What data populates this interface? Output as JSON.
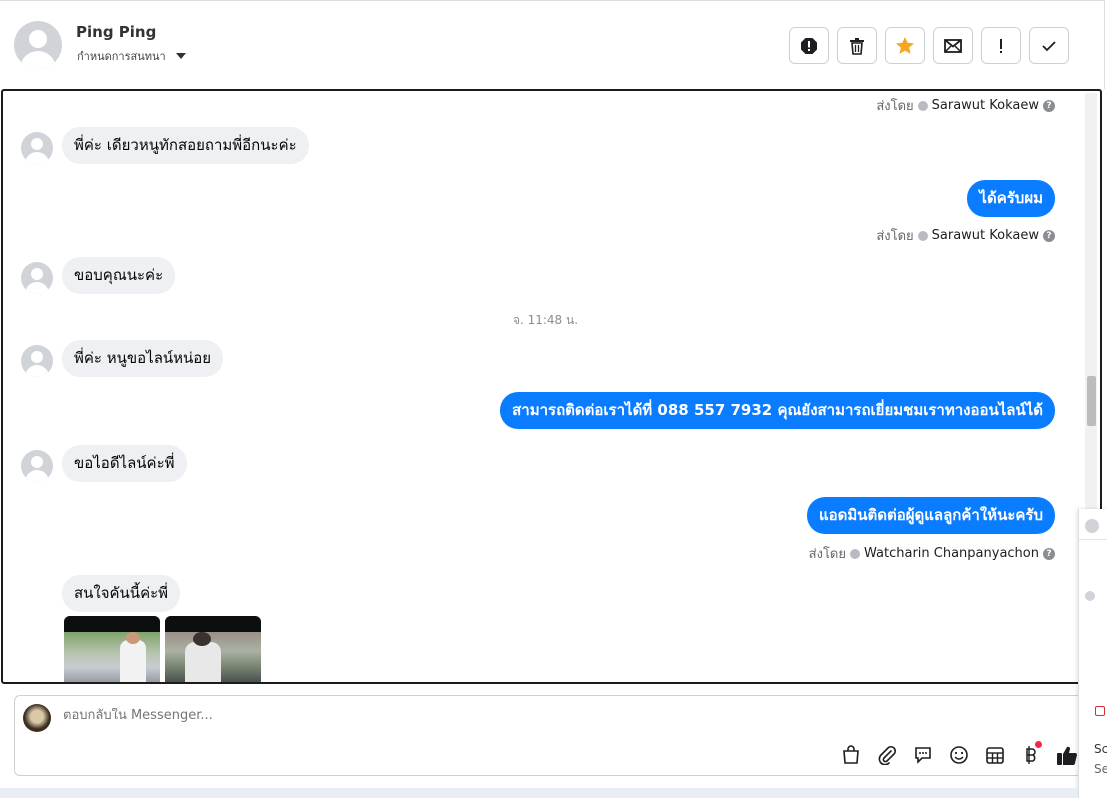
{
  "header": {
    "contact_name": "Ping Ping",
    "settings_label": "กำหนดการสนทนา",
    "actions": [
      {
        "name": "report-spam-button",
        "icon": "exclamation-octagon-icon"
      },
      {
        "name": "delete-button",
        "icon": "trash-icon"
      },
      {
        "name": "star-button",
        "icon": "star-icon"
      },
      {
        "name": "mark-unread-button",
        "icon": "envelope-icon"
      },
      {
        "name": "mark-important-button",
        "icon": "exclamation-icon"
      },
      {
        "name": "mark-done-button",
        "icon": "checkmark-icon"
      }
    ],
    "star_color": "#f5a623"
  },
  "chat": {
    "messages": [
      {
        "dir": "out-meta",
        "sent_by_label": "ส่งโดย",
        "sender": "Sarawut Kokaew"
      },
      {
        "dir": "in",
        "text": "พี่ค่ะ เดียวหนูทักสอยถามพี่อีกนะค่ะ"
      },
      {
        "dir": "out",
        "text": "ได้ครับผม",
        "sent_by_label": "ส่งโดย",
        "sender": "Sarawut Kokaew"
      },
      {
        "dir": "in",
        "text": "ขอบคุณนะค่ะ"
      },
      {
        "dir": "timestamp",
        "text": "จ. 11:48 น."
      },
      {
        "dir": "in",
        "text": "พี่ค่ะ หนูขอไลน์หน่อย"
      },
      {
        "dir": "out",
        "text": "สามารถติดต่อเราได้ที่ 088 557 7932 คุณยังสามารถเยี่ยมชมเราทางออนไลน์ได้"
      },
      {
        "dir": "in",
        "text": "ขอไอดีไลน์ค่ะพี่"
      },
      {
        "dir": "out",
        "text": "แอดมินติดต่อผู้ดูแลลูกค้าให้นะครับ",
        "sent_by_label": "ส่งโดย",
        "sender": "Watcharin Chanpanyachon"
      },
      {
        "dir": "in",
        "text": "สนใจคันนี้ค่ะพี่"
      }
    ],
    "out_bubble_color": "#0a7cff",
    "in_bubble_color": "#eef0f3"
  },
  "reply": {
    "placeholder": "ตอบกลับใน Messenger...",
    "tools": [
      "bag-icon",
      "paperclip-icon",
      "saved-replies-icon",
      "emoji-icon",
      "table-icon",
      "baht-icon",
      "thumbs-up-icon"
    ]
  },
  "side_widget": {
    "text_1": "Sc",
    "text_2": "Se"
  }
}
